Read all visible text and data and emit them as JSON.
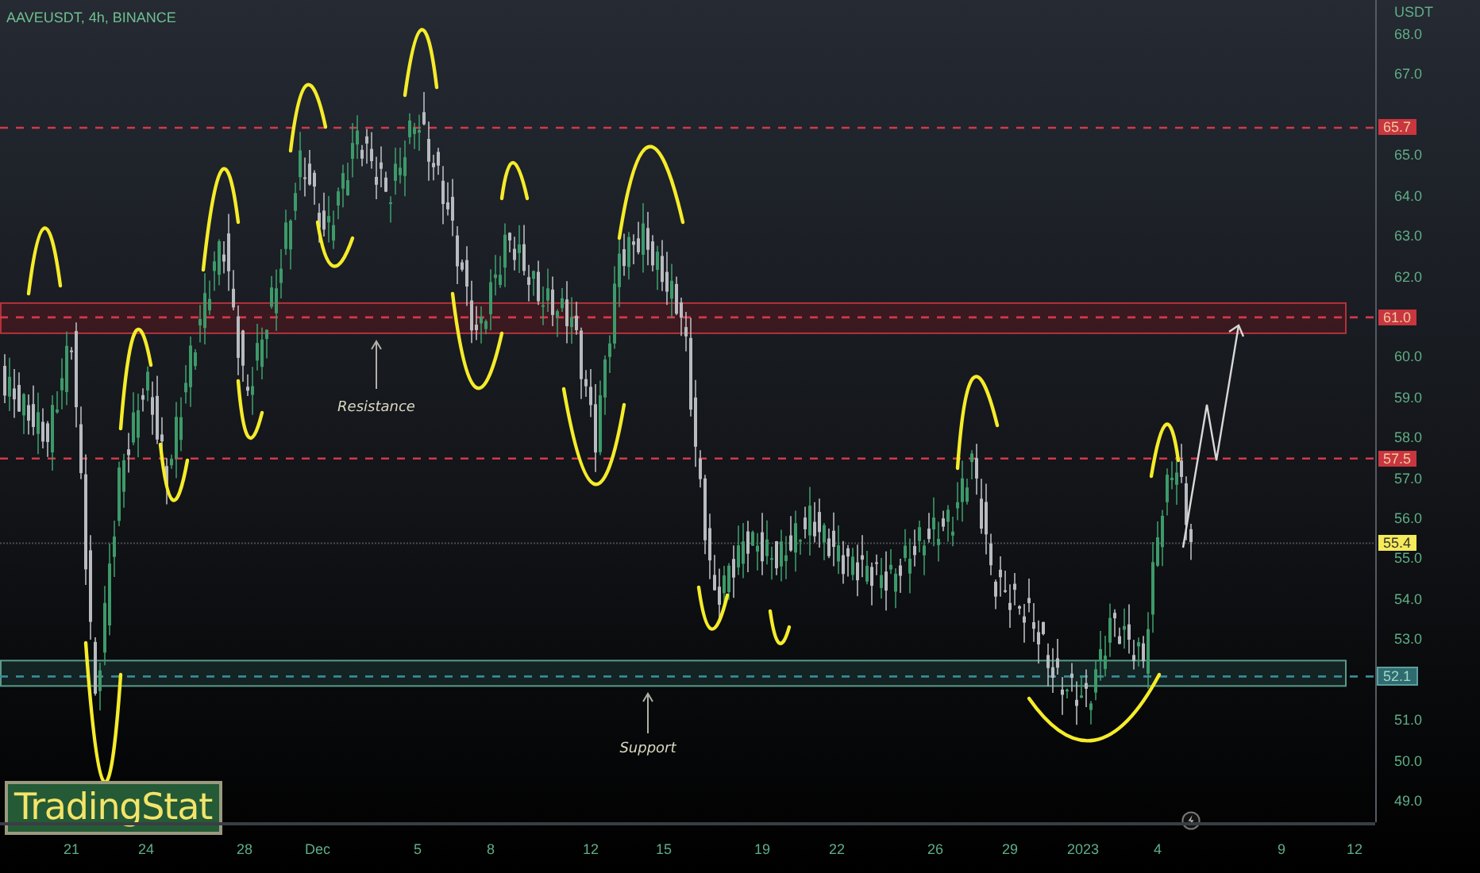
{
  "chart": {
    "symbol": "AAVEUSDT, 4h, BINANCE",
    "unit": "USDT",
    "price_ticks": [
      "68.0",
      "67.0",
      "65.0",
      "64.0",
      "63.0",
      "62.0",
      "60.0",
      "59.0",
      "58.0",
      "57.0",
      "56.0",
      "55.0",
      "54.0",
      "53.0",
      "51.0",
      "50.0",
      "49.0"
    ],
    "levels": [
      {
        "kind": "resistance",
        "label": "65.7",
        "color": "#c8363f",
        "zone": false
      },
      {
        "kind": "resistance",
        "label": "61.0",
        "color": "#c8363f",
        "zone": true
      },
      {
        "kind": "resistance",
        "label": "57.5",
        "color": "#c8363f",
        "zone": false
      },
      {
        "kind": "current",
        "label": "55.4",
        "color": "#f5ea5a",
        "zone": false
      },
      {
        "kind": "support",
        "label": "52.1",
        "color": "#2f6b6f",
        "zone": true
      }
    ],
    "annotations": [
      {
        "text": "Resistance"
      },
      {
        "text": "Support"
      }
    ],
    "time_ticks": [
      "21",
      "24",
      "28",
      "Dec",
      "5",
      "8",
      "12",
      "15",
      "19",
      "22",
      "26",
      "29",
      "2023",
      "4",
      "9",
      "12"
    ]
  },
  "logo": {
    "text": "TradingStat"
  }
}
